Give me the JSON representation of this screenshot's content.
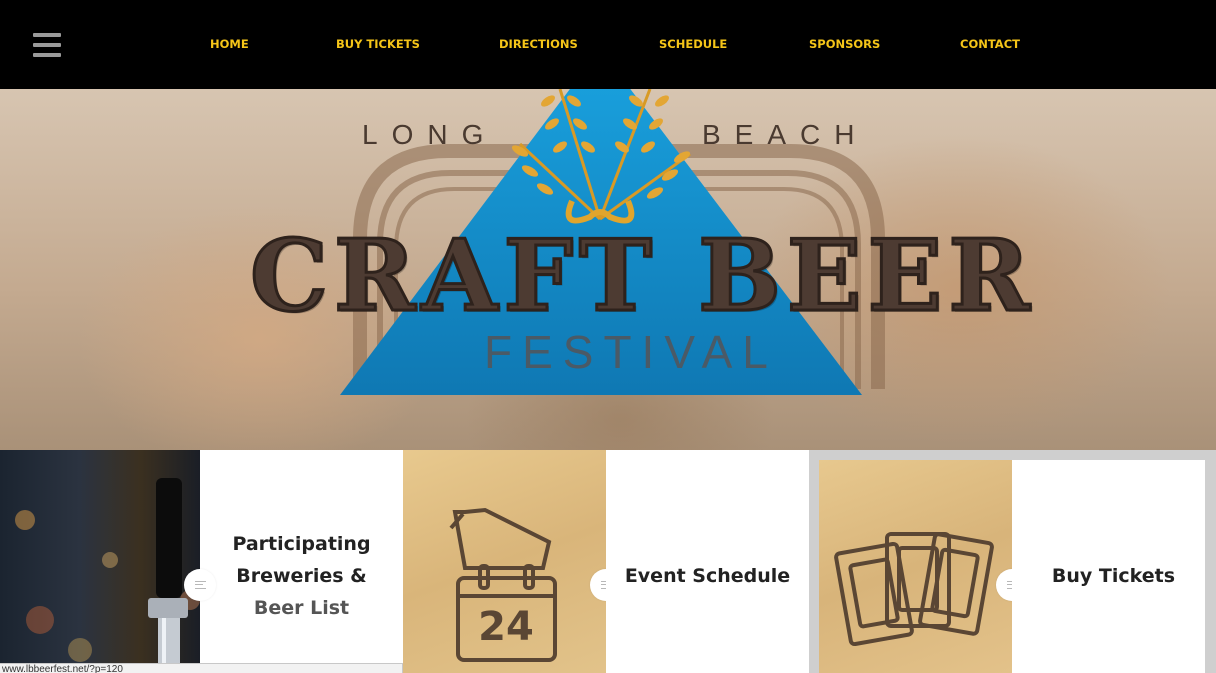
{
  "nav": {
    "menu_icon": "hamburger-menu-icon",
    "items": [
      "HOME",
      "BUY TICKETS",
      "DIRECTIONS",
      "SCHEDULE",
      "SPONSORS",
      "CONTACT"
    ],
    "color": "#f5c518"
  },
  "hero": {
    "logo": {
      "top_left": "LONG",
      "top_right": "BEACH",
      "main": "CRAFT BEER",
      "sub": "FESTIVAL"
    },
    "accent": "#1a8ed0"
  },
  "tiles": {
    "breweries": {
      "line1": "Participating",
      "line2": "Breweries &",
      "line3": "Beer List"
    },
    "schedule": {
      "label": "Event Schedule",
      "calendar_day": "24",
      "icon": "calendar-icon"
    },
    "tickets": {
      "label": "Buy Tickets",
      "icon": "tickets-icon"
    },
    "bullet_icon": "text-lines-icon"
  },
  "status_bar": {
    "url": "www.lbbeerfest.net/?p=120"
  }
}
